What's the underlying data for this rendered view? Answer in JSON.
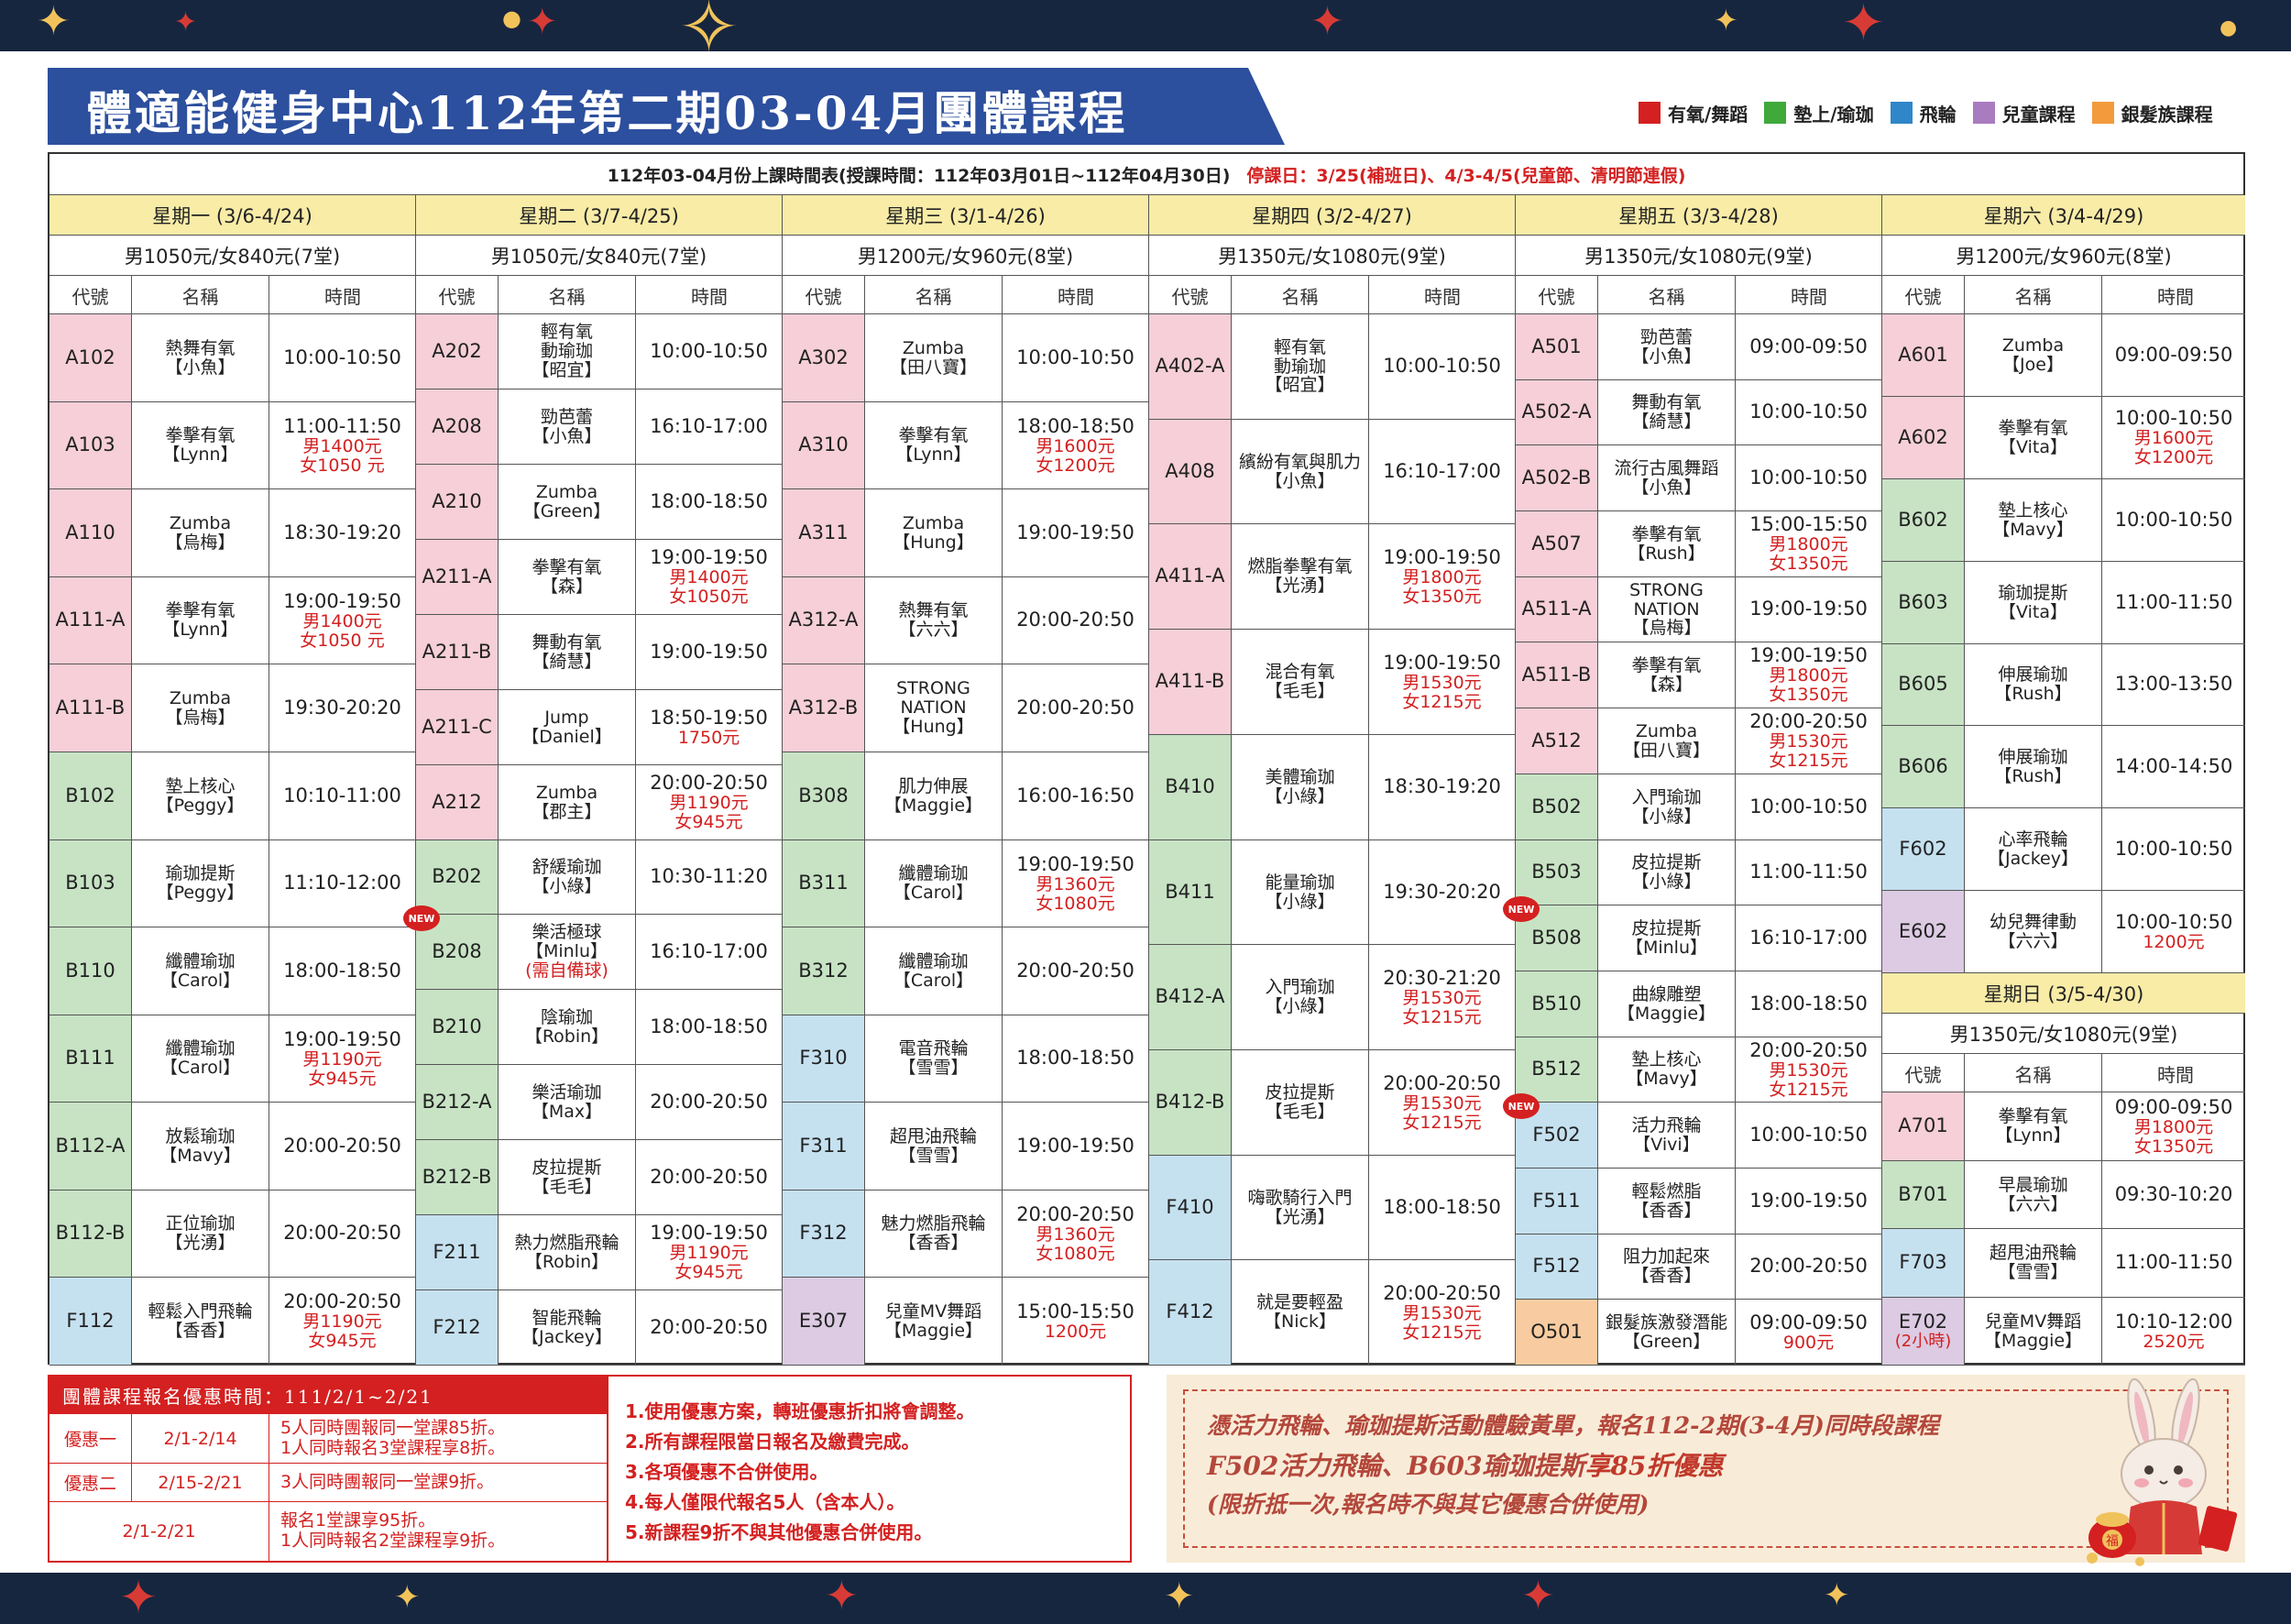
{
  "title": "體適能健身中心112年第二期03-04月團體課程",
  "legend": [
    {
      "label": "有氧/舞蹈",
      "color": "#d42020"
    },
    {
      "label": "墊上/瑜珈",
      "color": "#3fa93a"
    },
    {
      "label": "飛輪",
      "color": "#2f86c9"
    },
    {
      "label": "兒童課程",
      "color": "#a97cc0"
    },
    {
      "label": "銀髮族課程",
      "color": "#f39a3c"
    }
  ],
  "subtitle": "112年03-04月份上課時間表(授課時間：112年03月01日~112年04月30日)",
  "stop_days": "停課日：3/25(補班日)、4/3-4/5(兒童節、清明節連假)",
  "col_headers": {
    "code": "代號",
    "name": "名稱",
    "time": "時間"
  },
  "days": [
    {
      "header": "星期一 (3/6-4/24)",
      "price": "男1050元/女840元(7堂)",
      "rows": [
        {
          "code": "A102",
          "name": [
            "熱舞有氧",
            "【小魚】"
          ],
          "time": [
            "10:00-10:50"
          ],
          "color": "red"
        },
        {
          "code": "A103",
          "name": [
            "拳擊有氧",
            "【Lynn】"
          ],
          "time": [
            "11:00-11:50"
          ],
          "price": [
            "男1400元",
            "女1050 元"
          ],
          "color": "red"
        },
        {
          "code": "A110",
          "name": [
            "Zumba",
            "【烏梅】"
          ],
          "time": [
            "18:30-19:20"
          ],
          "color": "red"
        },
        {
          "code": "A111-A",
          "name": [
            "拳擊有氧",
            "【Lynn】"
          ],
          "time": [
            "19:00-19:50"
          ],
          "price": [
            "男1400元",
            "女1050 元"
          ],
          "color": "red"
        },
        {
          "code": "A111-B",
          "name": [
            "Zumba",
            "【烏梅】"
          ],
          "time": [
            "19:30-20:20"
          ],
          "color": "red"
        },
        {
          "code": "B102",
          "name": [
            "墊上核心",
            "【Peggy】"
          ],
          "time": [
            "10:10-11:00"
          ],
          "color": "grn"
        },
        {
          "code": "B103",
          "name": [
            "瑜珈提斯",
            "【Peggy】"
          ],
          "time": [
            "11:10-12:00"
          ],
          "color": "grn"
        },
        {
          "code": "B110",
          "name": [
            "纖體瑜珈",
            "【Carol】"
          ],
          "time": [
            "18:00-18:50"
          ],
          "color": "grn"
        },
        {
          "code": "B111",
          "name": [
            "纖體瑜珈",
            "【Carol】"
          ],
          "time": [
            "19:00-19:50"
          ],
          "price": [
            "男1190元",
            "女945元"
          ],
          "color": "grn"
        },
        {
          "code": "B112-A",
          "name": [
            "放鬆瑜珈",
            "【Mavy】"
          ],
          "time": [
            "20:00-20:50"
          ],
          "color": "grn"
        },
        {
          "code": "B112-B",
          "name": [
            "正位瑜珈",
            "【光湧】"
          ],
          "time": [
            "20:00-20:50"
          ],
          "color": "grn"
        },
        {
          "code": "F112",
          "name": [
            "輕鬆入門飛輪",
            "【香香】"
          ],
          "time": [
            "20:00-20:50"
          ],
          "price": [
            "男1190元",
            "女945元"
          ],
          "color": "blu"
        }
      ]
    },
    {
      "header": "星期二 (3/7-4/25)",
      "price": "男1050元/女840元(7堂)",
      "rows": [
        {
          "code": "A202",
          "name": [
            "輕有氧",
            "動瑜珈",
            "【昭宜】"
          ],
          "time": [
            "10:00-10:50"
          ],
          "color": "red"
        },
        {
          "code": "A208",
          "name": [
            "勁芭蕾",
            "【小魚】"
          ],
          "time": [
            "16:10-17:00"
          ],
          "color": "red"
        },
        {
          "code": "A210",
          "name": [
            "Zumba",
            "【Green】"
          ],
          "time": [
            "18:00-18:50"
          ],
          "color": "red"
        },
        {
          "code": "A211-A",
          "name": [
            "拳擊有氧",
            "【森】"
          ],
          "time": [
            "19:00-19:50"
          ],
          "price": [
            "男1400元",
            "女1050元"
          ],
          "color": "red"
        },
        {
          "code": "A211-B",
          "name": [
            "舞動有氧",
            "【綺慧】"
          ],
          "time": [
            "19:00-19:50"
          ],
          "color": "red"
        },
        {
          "code": "A211-C",
          "name": [
            "Jump",
            "【Daniel】"
          ],
          "time": [
            "18:50-19:50"
          ],
          "price": [
            "1750元"
          ],
          "color": "red"
        },
        {
          "code": "A212",
          "name": [
            "Zumba",
            "【郡主】"
          ],
          "time": [
            "20:00-20:50"
          ],
          "price": [
            "男1190元",
            "女945元"
          ],
          "color": "red"
        },
        {
          "code": "B202",
          "name": [
            "舒緩瑜珈",
            "【小綠】"
          ],
          "time": [
            "10:30-11:20"
          ],
          "color": "grn"
        },
        {
          "code": "B208",
          "name": [
            "樂活極球",
            "【Minlu】"
          ],
          "name_note": "(需自備球)",
          "time": [
            "16:10-17:00"
          ],
          "color": "grn",
          "new": true
        },
        {
          "code": "B210",
          "name": [
            "陰瑜珈",
            "【Robin】"
          ],
          "time": [
            "18:00-18:50"
          ],
          "color": "grn"
        },
        {
          "code": "B212-A",
          "name": [
            "樂活瑜珈",
            "【Max】"
          ],
          "time": [
            "20:00-20:50"
          ],
          "color": "grn"
        },
        {
          "code": "B212-B",
          "name": [
            "皮拉提斯",
            "【毛毛】"
          ],
          "time": [
            "20:00-20:50"
          ],
          "color": "grn"
        },
        {
          "code": "F211",
          "name": [
            "熱力燃脂飛輪",
            "【Robin】"
          ],
          "time": [
            "19:00-19:50"
          ],
          "price": [
            "男1190元",
            "女945元"
          ],
          "color": "blu"
        },
        {
          "code": "F212",
          "name": [
            "智能飛輪",
            "【Jackey】"
          ],
          "time": [
            "20:00-20:50"
          ],
          "color": "blu"
        }
      ]
    },
    {
      "header": "星期三 (3/1-4/26)",
      "price": "男1200元/女960元(8堂)",
      "rows": [
        {
          "code": "A302",
          "name": [
            "Zumba",
            "【田八寶】"
          ],
          "time": [
            "10:00-10:50"
          ],
          "color": "red"
        },
        {
          "code": "A310",
          "name": [
            "拳擊有氧",
            "【Lynn】"
          ],
          "time": [
            "18:00-18:50"
          ],
          "price": [
            "男1600元",
            "女1200元"
          ],
          "color": "red"
        },
        {
          "code": "A311",
          "name": [
            "Zumba",
            "【Hung】"
          ],
          "time": [
            "19:00-19:50"
          ],
          "color": "red"
        },
        {
          "code": "A312-A",
          "name": [
            "熱舞有氧",
            "【六六】"
          ],
          "time": [
            "20:00-20:50"
          ],
          "color": "red"
        },
        {
          "code": "A312-B",
          "name": [
            "STRONG",
            "NATION",
            "【Hung】"
          ],
          "time": [
            "20:00-20:50"
          ],
          "color": "red"
        },
        {
          "code": "B308",
          "name": [
            "肌力伸展",
            "【Maggie】"
          ],
          "time": [
            "16:00-16:50"
          ],
          "color": "grn"
        },
        {
          "code": "B311",
          "name": [
            "纖體瑜珈",
            "【Carol】"
          ],
          "time": [
            "19:00-19:50"
          ],
          "price": [
            "男1360元",
            "女1080元"
          ],
          "color": "grn"
        },
        {
          "code": "B312",
          "name": [
            "纖體瑜珈",
            "【Carol】"
          ],
          "time": [
            "20:00-20:50"
          ],
          "color": "grn"
        },
        {
          "code": "F310",
          "name": [
            "電音飛輪",
            "【雪雪】"
          ],
          "time": [
            "18:00-18:50"
          ],
          "color": "blu"
        },
        {
          "code": "F311",
          "name": [
            "超甩油飛輪",
            "【雪雪】"
          ],
          "time": [
            "19:00-19:50"
          ],
          "color": "blu"
        },
        {
          "code": "F312",
          "name": [
            "魅力燃脂飛輪",
            "【香香】"
          ],
          "time": [
            "20:00-20:50"
          ],
          "price": [
            "男1360元",
            "女1080元"
          ],
          "color": "blu"
        },
        {
          "code": "E307",
          "name": [
            "兒童MV舞蹈",
            "【Maggie】"
          ],
          "time": [
            "15:00-15:50"
          ],
          "price": [
            "1200元"
          ],
          "color": "pur"
        }
      ]
    },
    {
      "header": "星期四 (3/2-4/27)",
      "price": "男1350元/女1080元(9堂)",
      "rows": [
        {
          "code": "A402-A",
          "name": [
            "輕有氧",
            "動瑜珈",
            "【昭宜】"
          ],
          "time": [
            "10:00-10:50"
          ],
          "color": "red"
        },
        {
          "code": "A408",
          "name": [
            "繽紛有氧與肌力",
            "【小魚】"
          ],
          "time": [
            "16:10-17:00"
          ],
          "color": "red"
        },
        {
          "code": "A411-A",
          "name": [
            "燃脂拳擊有氧",
            "【光湧】"
          ],
          "time": [
            "19:00-19:50"
          ],
          "price": [
            "男1800元",
            "女1350元"
          ],
          "color": "red"
        },
        {
          "code": "A411-B",
          "name": [
            "混合有氧",
            "【毛毛】"
          ],
          "time": [
            "19:00-19:50"
          ],
          "price": [
            "男1530元",
            "女1215元"
          ],
          "color": "red"
        },
        {
          "code": "B410",
          "name": [
            "美體瑜珈",
            "【小綠】"
          ],
          "time": [
            "18:30-19:20"
          ],
          "color": "grn"
        },
        {
          "code": "B411",
          "name": [
            "能量瑜珈",
            "【小綠】"
          ],
          "time": [
            "19:30-20:20"
          ],
          "color": "grn"
        },
        {
          "code": "B412-A",
          "name": [
            "入門瑜珈",
            "【小綠】"
          ],
          "time": [
            "20:30-21:20"
          ],
          "price": [
            "男1530元",
            "女1215元"
          ],
          "color": "grn"
        },
        {
          "code": "B412-B",
          "name": [
            "皮拉提斯",
            "【毛毛】"
          ],
          "time": [
            "20:00-20:50"
          ],
          "price": [
            "男1530元",
            "女1215元"
          ],
          "color": "grn"
        },
        {
          "code": "F410",
          "name": [
            "嗨歌騎行入門",
            "【光湧】"
          ],
          "time": [
            "18:00-18:50"
          ],
          "color": "blu"
        },
        {
          "code": "F412",
          "name": [
            "就是要輕盈",
            "【Nick】"
          ],
          "time": [
            "20:00-20:50"
          ],
          "price": [
            "男1530元",
            "女1215元"
          ],
          "color": "blu"
        }
      ]
    },
    {
      "header": "星期五 (3/3-4/28)",
      "price": "男1350元/女1080元(9堂)",
      "rows": [
        {
          "code": "A501",
          "name": [
            "勁芭蕾",
            "【小魚】"
          ],
          "time": [
            "09:00-09:50"
          ],
          "color": "red"
        },
        {
          "code": "A502-A",
          "name": [
            "舞動有氧",
            "【綺慧】"
          ],
          "time": [
            "10:00-10:50"
          ],
          "color": "red"
        },
        {
          "code": "A502-B",
          "name": [
            "流行古風舞蹈",
            "【小魚】"
          ],
          "time": [
            "10:00-10:50"
          ],
          "color": "red"
        },
        {
          "code": "A507",
          "name": [
            "拳擊有氧",
            "【Rush】"
          ],
          "time": [
            "15:00-15:50"
          ],
          "price": [
            "男1800元",
            "女1350元"
          ],
          "color": "red"
        },
        {
          "code": "A511-A",
          "name": [
            "STRONG",
            "NATION",
            "【烏梅】"
          ],
          "time": [
            "19:00-19:50"
          ],
          "color": "red"
        },
        {
          "code": "A511-B",
          "name": [
            "拳擊有氧",
            "【森】"
          ],
          "time": [
            "19:00-19:50"
          ],
          "price": [
            "男1800元",
            "女1350元"
          ],
          "color": "red"
        },
        {
          "code": "A512",
          "name": [
            "Zumba",
            "【田八寶】"
          ],
          "time": [
            "20:00-20:50"
          ],
          "price": [
            "男1530元",
            "女1215元"
          ],
          "color": "red"
        },
        {
          "code": "B502",
          "name": [
            "入門瑜珈",
            "【小綠】"
          ],
          "time": [
            "10:00-10:50"
          ],
          "color": "grn"
        },
        {
          "code": "B503",
          "name": [
            "皮拉提斯",
            "【小綠】"
          ],
          "time": [
            "11:00-11:50"
          ],
          "color": "grn"
        },
        {
          "code": "B508",
          "name": [
            "皮拉提斯",
            "【Minlu】"
          ],
          "time": [
            "16:10-17:00"
          ],
          "color": "grn",
          "new": true
        },
        {
          "code": "B510",
          "name": [
            "曲線雕塑",
            "【Maggie】"
          ],
          "time": [
            "18:00-18:50"
          ],
          "color": "grn"
        },
        {
          "code": "B512",
          "name": [
            "墊上核心",
            "【Mavy】"
          ],
          "time": [
            "20:00-20:50"
          ],
          "price": [
            "男1530元",
            "女1215元"
          ],
          "color": "grn"
        },
        {
          "code": "F502",
          "name": [
            "活力飛輪",
            "【Vivi】"
          ],
          "time": [
            "10:00-10:50"
          ],
          "color": "blu",
          "new": true
        },
        {
          "code": "F511",
          "name": [
            "輕鬆燃脂",
            "【香香】"
          ],
          "time": [
            "19:00-19:50"
          ],
          "color": "blu"
        },
        {
          "code": "F512",
          "name": [
            "阻力加起來",
            "【香香】"
          ],
          "time": [
            "20:00-20:50"
          ],
          "color": "blu"
        },
        {
          "code": "O501",
          "name": [
            "銀髮族激發潛能",
            "【Green】"
          ],
          "time": [
            "09:00-09:50"
          ],
          "price": [
            "900元"
          ],
          "color": "org"
        }
      ]
    },
    {
      "header": "星期六 (3/4-4/29)",
      "price": "男1200元/女960元(8堂)",
      "rows": [
        {
          "code": "A601",
          "name": [
            "Zumba",
            "【Joe】"
          ],
          "time": [
            "09:00-09:50"
          ],
          "color": "red"
        },
        {
          "code": "A602",
          "name": [
            "拳擊有氧",
            "【Vita】"
          ],
          "time": [
            "10:00-10:50"
          ],
          "price": [
            "男1600元",
            "女1200元"
          ],
          "color": "red"
        },
        {
          "code": "B602",
          "name": [
            "墊上核心",
            "【Mavy】"
          ],
          "time": [
            "10:00-10:50"
          ],
          "color": "grn"
        },
        {
          "code": "B603",
          "name": [
            "瑜珈提斯",
            "【Vita】"
          ],
          "time": [
            "11:00-11:50"
          ],
          "color": "grn"
        },
        {
          "code": "B605",
          "name": [
            "伸展瑜珈",
            "【Rush】"
          ],
          "time": [
            "13:00-13:50"
          ],
          "color": "grn"
        },
        {
          "code": "B606",
          "name": [
            "伸展瑜珈",
            "【Rush】"
          ],
          "time": [
            "14:00-14:50"
          ],
          "color": "grn"
        },
        {
          "code": "F602",
          "name": [
            "心率飛輪",
            "【Jackey】"
          ],
          "time": [
            "10:00-10:50"
          ],
          "color": "blu"
        },
        {
          "code": "E602",
          "name": [
            "幼兒舞律動",
            "【六六】"
          ],
          "time": [
            "10:00-10:50"
          ],
          "price": [
            "1200元"
          ],
          "color": "pur"
        }
      ]
    }
  ],
  "sunday": {
    "header": "星期日 (3/5-4/30)",
    "price": "男1350元/女1080元(9堂)",
    "rows": [
      {
        "code": "A701",
        "name": [
          "拳擊有氧",
          "【Lynn】"
        ],
        "time": [
          "09:00-09:50"
        ],
        "price": [
          "男1800元",
          "女1350元"
        ],
        "color": "red"
      },
      {
        "code": "B701",
        "name": [
          "早晨瑜珈",
          "【六六】"
        ],
        "time": [
          "09:30-10:20"
        ],
        "color": "grn"
      },
      {
        "code": "F703",
        "name": [
          "超甩油飛輪",
          "【雪雪】"
        ],
        "time": [
          "11:00-11:50"
        ],
        "color": "blu"
      },
      {
        "code": "E702",
        "code_note": "(2小時)",
        "name": [
          "兒童MV舞蹈",
          "【Maggie】"
        ],
        "time": [
          "10:10-12:00"
        ],
        "price": [
          "2520元"
        ],
        "color": "pur"
      }
    ]
  },
  "new_badge": "NEW",
  "promo": {
    "heading": "團體課程報名優惠時間：111/2/1~2/21",
    "rows": [
      {
        "label": "優惠一",
        "date": "2/1-2/14",
        "desc": [
          "5人同時團報同一堂課85折。",
          "1人同時報名3堂課程享8折。"
        ]
      },
      {
        "label": "優惠二",
        "date": "2/15-2/21",
        "desc": [
          "3人同時團報同一堂課9折。"
        ]
      },
      {
        "label": "",
        "date": "2/1-2/21",
        "desc": [
          "報名1堂課享95折。",
          "1人同時報名2堂課程享9折。"
        ]
      }
    ],
    "rules": [
      "1.使用優惠方案，轉班優惠折扣將會調整。",
      "2.所有課程限當日報名及繳費完成。",
      "3.各項優惠不合併使用。",
      "4.每人僅限代報名5人（含本人）。",
      "5.新課程9折不與其他優惠合併使用。"
    ]
  },
  "offer": {
    "line1": "憑活力飛輪、瑜珈提斯活動體驗黃單，報名112-2期(3-4月)同時段課程",
    "line2a": "F502活力飛輪、B603瑜珈提斯",
    "line2b": "享85折優惠",
    "line3": "(限折抵一次,報名時不與其它優惠合併使用)"
  },
  "rabbit_badge": "福"
}
